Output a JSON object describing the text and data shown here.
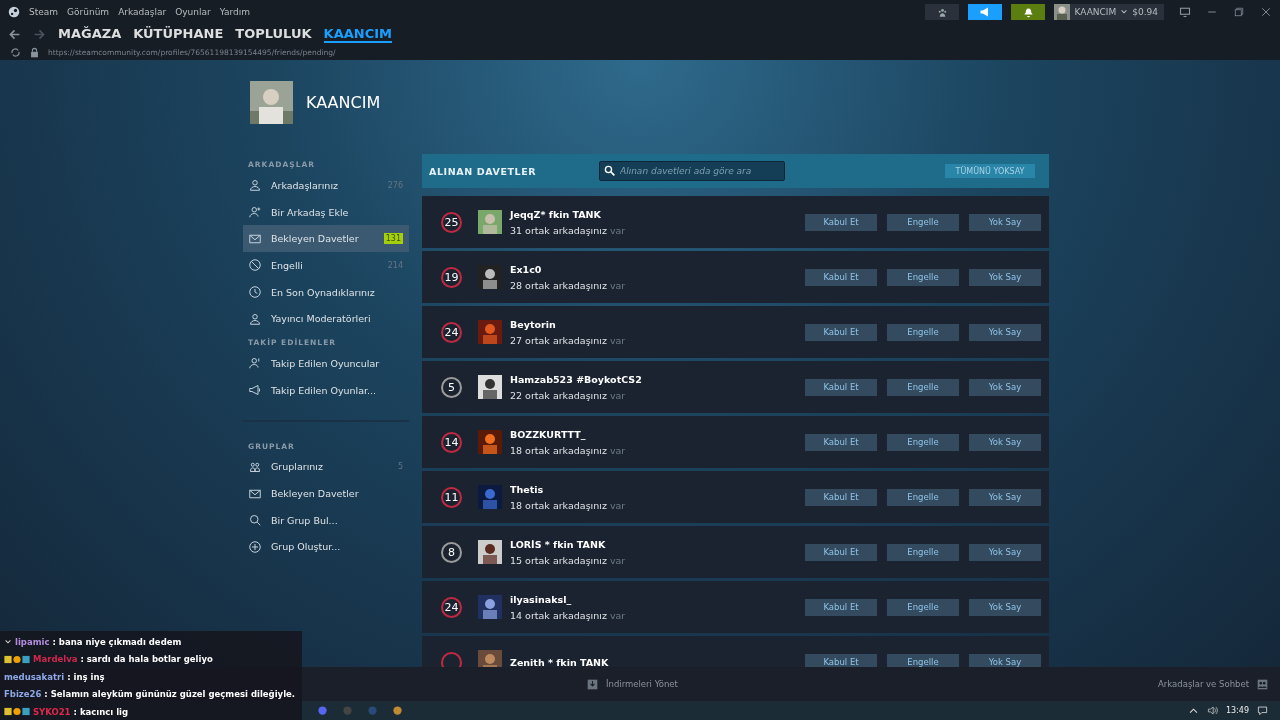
{
  "menu": [
    "Steam",
    "Görünüm",
    "Arkadaşlar",
    "Oyunlar",
    "Yardım"
  ],
  "account": {
    "name": "KAANCIM",
    "balance": "$0.94"
  },
  "nav_tabs": [
    {
      "label": "MAĞAZA",
      "selected": false
    },
    {
      "label": "KÜTÜPHANE",
      "selected": false
    },
    {
      "label": "TOPLULUK",
      "selected": false
    },
    {
      "label": "KAANCIM",
      "selected": true
    }
  ],
  "url": "https://steamcommunity.com/profiles/76561198139154495/friends/pending/",
  "profile": {
    "name": "KAANCIM"
  },
  "sidebar": [
    {
      "heading": "ARKADAŞLAR",
      "items": [
        {
          "label": "Arkadaşlarınız",
          "count": "276",
          "selected": false
        },
        {
          "label": "Bir Arkadaş Ekle",
          "selected": false
        },
        {
          "label": "Bekleyen Davetler",
          "badge": "131",
          "selected": true
        },
        {
          "label": "Engelli",
          "count": "214",
          "selected": false
        },
        {
          "label": "En Son Oynadıklarınız",
          "selected": false
        },
        {
          "label": "Yayıncı Moderatörleri",
          "selected": false
        }
      ]
    },
    {
      "heading": "TAKİP EDİLENLER",
      "items": [
        {
          "label": "Takip Edilen Oyuncular",
          "selected": false
        },
        {
          "label": "Takip Edilen Oyunlar...",
          "selected": false
        }
      ]
    },
    {
      "heading": "GRUPLAR",
      "items": [
        {
          "label": "Gruplarınız",
          "count": "5",
          "selected": false
        },
        {
          "label": "Bekleyen Davetler",
          "selected": false
        },
        {
          "label": "Bir Grup Bul...",
          "selected": false
        },
        {
          "label": "Grup Oluştur...",
          "selected": false
        }
      ]
    }
  ],
  "invites": {
    "title": "ALINAN DAVETLER",
    "search": {
      "placeholder": "Alınan davetleri ada göre ara"
    },
    "ignore_all": "TÜMÜNÜ YOKSAY",
    "rows": [
      {
        "level": "25",
        "color": "#c02942",
        "name": "JeqqZ* fkin TANK",
        "mutual": "31 ortak arkadaşınız",
        "suffix": "var",
        "actions": [
          "Kabul Et",
          "Engelle",
          "Yok Say"
        ]
      },
      {
        "level": "19",
        "color": "#c02942",
        "name": "Ex1c0",
        "mutual": "28 ortak arkadaşınız",
        "suffix": "var",
        "actions": [
          "Kabul Et",
          "Engelle",
          "Yok Say"
        ]
      },
      {
        "level": "24",
        "color": "#c02942",
        "name": "Beytorin",
        "mutual": "27 ortak arkadaşınız",
        "suffix": "var",
        "actions": [
          "Kabul Et",
          "Engelle",
          "Yok Say"
        ]
      },
      {
        "level": "5",
        "color": "#9b9b9b",
        "name": "Hamzab523 #BoykotCS2",
        "mutual": "22 ortak arkadaşınız",
        "suffix": "var",
        "actions": [
          "Kabul Et",
          "Engelle",
          "Yok Say"
        ]
      },
      {
        "level": "14",
        "color": "#c02942",
        "name": "BOZZKURTTT_",
        "mutual": "18 ortak arkadaşınız",
        "suffix": "var",
        "actions": [
          "Kabul Et",
          "Engelle",
          "Yok Say"
        ]
      },
      {
        "level": "11",
        "color": "#c02942",
        "name": "Thetis",
        "mutual": "18 ortak arkadaşınız",
        "suffix": "var",
        "actions": [
          "Kabul Et",
          "Engelle",
          "Yok Say"
        ]
      },
      {
        "level": "8",
        "color": "#9b9b9b",
        "name": "LORİS * fkin TANK",
        "mutual": "15 ortak arkadaşınız",
        "suffix": "var",
        "actions": [
          "Kabul Et",
          "Engelle",
          "Yok Say"
        ]
      },
      {
        "level": "24",
        "color": "#c02942",
        "name": "ilyasinaksl_",
        "mutual": "14 ortak arkadaşınız",
        "suffix": "var",
        "actions": [
          "Kabul Et",
          "Engelle",
          "Yok Say"
        ]
      },
      {
        "color": "#c02942",
        "name": "Zenith * fkin TANK",
        "actions": [
          "Kabul Et",
          "Engelle",
          "Yok Say"
        ]
      }
    ]
  },
  "bottom_bar": {
    "downloads": "İndirmeleri Yönet",
    "friends": "Arkadaşlar ve Sohbet"
  },
  "chat": [
    {
      "user": "lipamic",
      "color": "#b48ce0",
      "text": ": bana niye çıkmadı dedem",
      "kind": "collapse"
    },
    {
      "user": "Mardelva",
      "color": "#d0284c",
      "text": ": sardı da hala botlar geliyo",
      "kind": "badges"
    },
    {
      "user": "medusakatri",
      "color": "#8ea8e8",
      "text": ": inş inş",
      "kind": "plain"
    },
    {
      "user": "Fbize26",
      "color": "#8ea8e8",
      "text": ": Selamın aleyküm gününüz güzel geçmesi dileğiyle.",
      "kind": "plain"
    },
    {
      "user": "SYKO21",
      "color": "#e0284c",
      "text": ": kacıncı lig",
      "kind": "badges"
    }
  ],
  "clock": "13:49"
}
